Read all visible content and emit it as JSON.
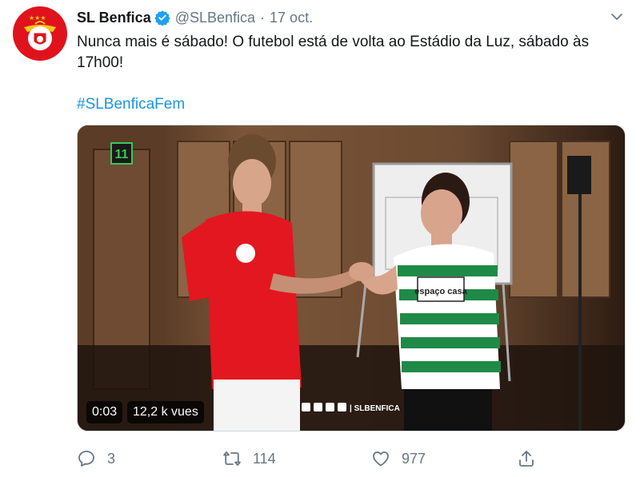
{
  "tweet": {
    "display_name": "SL Benfica",
    "handle": "@SLBenfica",
    "separator": "·",
    "date": "17 oct.",
    "text": "Nunca mais é sábado! O futebol está de volta ao Estádio da Luz, sábado às 17h00!",
    "hashtag": "#SLBenficaFem"
  },
  "video": {
    "time": "0:03",
    "views": "12,2 k vues",
    "watermark": "| SLBENFICA",
    "channel_badge": "11",
    "shirt_sponsor": "espaço casa"
  },
  "actions": {
    "replies": "3",
    "retweets": "114",
    "likes": "977"
  },
  "colors": {
    "brand_red": "#e0131d",
    "link_blue": "#1b95e0",
    "muted_gray": "#657786"
  },
  "icons": [
    "verified-badge-icon",
    "chevron-down-icon",
    "reply-icon",
    "retweet-icon",
    "like-icon",
    "share-icon"
  ]
}
